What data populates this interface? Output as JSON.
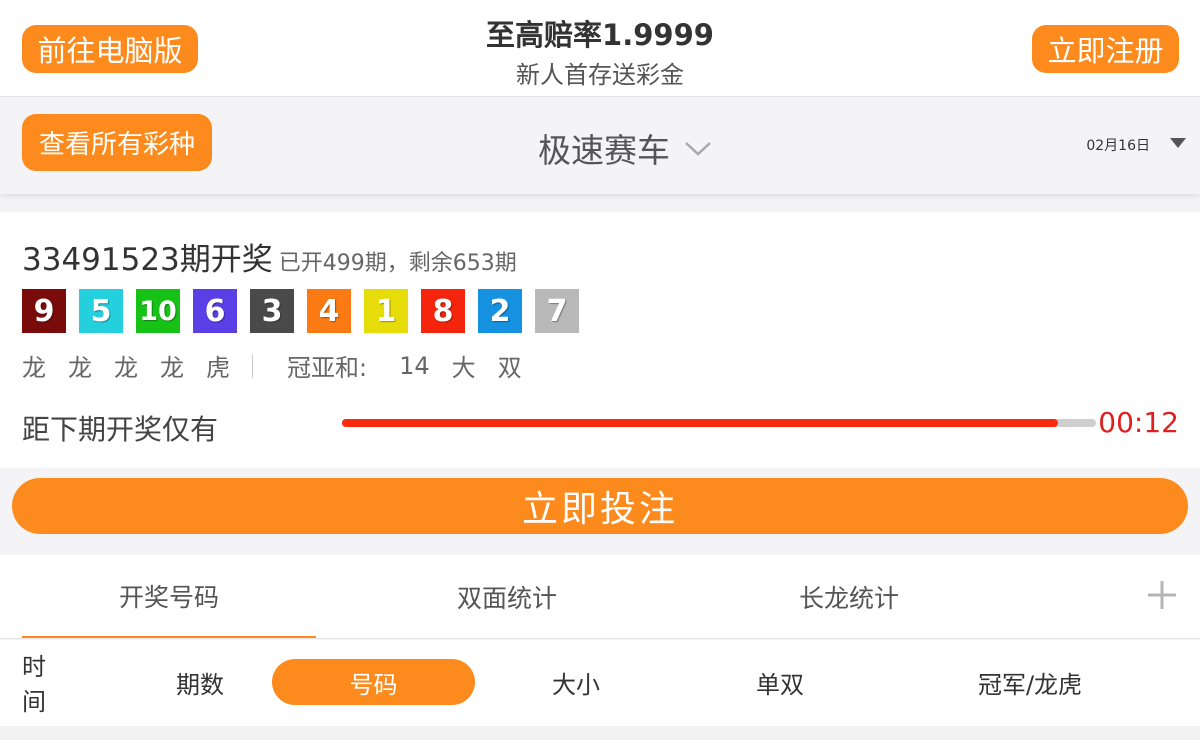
{
  "header": {
    "pc_button": "前往电脑版",
    "register_button": "立即注册",
    "promo_title": "至高赔率1.9999",
    "promo_subtitle": "新人首存送彩金"
  },
  "selector": {
    "all_lotteries_button": "查看所有彩种",
    "lottery_name": "极速赛车",
    "date": "02月16日"
  },
  "result": {
    "period_title": "33491523期开奖",
    "period_info": "已开499期，剩余653期",
    "balls": [
      {
        "num": "9",
        "color": "#7a0b0b"
      },
      {
        "num": "5",
        "color": "#25d0de"
      },
      {
        "num": "10",
        "color": "#16c216"
      },
      {
        "num": "6",
        "color": "#5a3fe6"
      },
      {
        "num": "3",
        "color": "#4a4a4a"
      },
      {
        "num": "4",
        "color": "#fb7a14"
      },
      {
        "num": "1",
        "color": "#e6dc0a"
      },
      {
        "num": "8",
        "color": "#f5250d"
      },
      {
        "num": "2",
        "color": "#1692e0"
      },
      {
        "num": "7",
        "color": "#b9b9b9"
      }
    ],
    "dragon_tiger": [
      "龙",
      "龙",
      "龙",
      "龙",
      "虎"
    ],
    "sum_label": "冠亚和:",
    "sum_value": "14",
    "size": "大",
    "parity": "双",
    "countdown_label": "距下期开奖仅有",
    "countdown_progress": 0.95,
    "countdown_time": "00:12"
  },
  "bet_button": "立即投注",
  "tabs": [
    "开奖号码",
    "双面统计",
    "长龙统计"
  ],
  "subtabs": [
    "时间",
    "期数",
    "号码",
    "大小",
    "单双",
    "冠军/龙虎"
  ],
  "colors": {
    "accent": "#fc8a1c",
    "progress": "#fa2b0c",
    "timer": "#e02020"
  },
  "icons": {
    "lottery_dropdown": "chevron-down-icon",
    "date_dropdown": "caret-down-icon",
    "more_tabs": "plus-icon"
  }
}
